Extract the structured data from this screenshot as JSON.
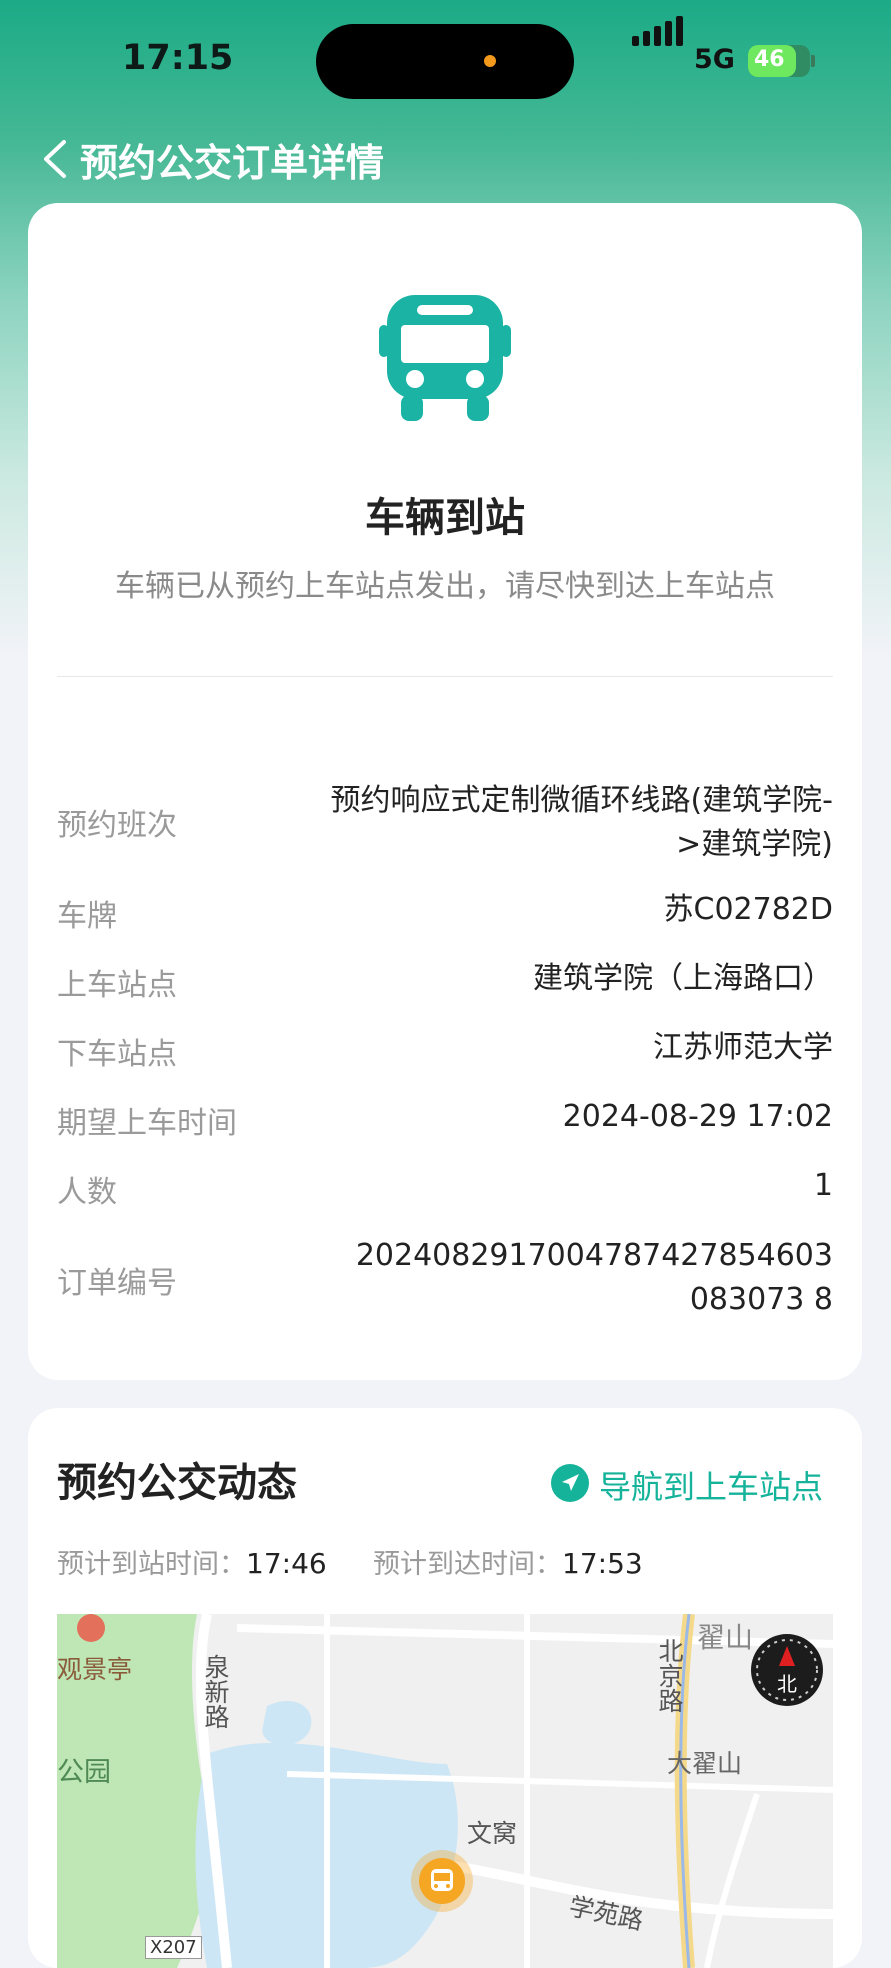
{
  "status_bar": {
    "time": "17:15",
    "network": "5G",
    "battery": "46"
  },
  "nav": {
    "title": "预约公交订单详情"
  },
  "order_status": {
    "title": "车辆到站",
    "description": "车辆已从预约上车站点发出，请尽快到达上车站点"
  },
  "details": [
    {
      "label": "预约班次",
      "value": "预约响应式定制微循环线路(建筑学院->建筑学院)"
    },
    {
      "label": "车牌",
      "value": "苏C02782D"
    },
    {
      "label": "上车站点",
      "value": "建筑学院（上海路口）"
    },
    {
      "label": "下车站点",
      "value": "江苏师范大学"
    },
    {
      "label": "期望上车时间",
      "value": "2024-08-29 17:02"
    },
    {
      "label": "人数",
      "value": "1"
    },
    {
      "label": "订单编号",
      "value": "2024082917004787427854603083073 8"
    }
  ],
  "dynamics": {
    "title": "预约公交动态",
    "nav_button": "导航到上车站点",
    "eta_station_label": "预计到站时间：",
    "eta_station": "17:46",
    "eta_arrival_label": "预计到达时间：",
    "eta_arrival": "17:53"
  },
  "map": {
    "labels": [
      "观景亭",
      "泉新路",
      "北京路",
      "翟山",
      "大翟山",
      "公园",
      "文窝",
      "学苑路",
      "X207"
    ],
    "compass": "北"
  },
  "colors": {
    "accent": "#14b39a",
    "brand_green": "#1bab86",
    "bus_marker": "#f5a623"
  }
}
